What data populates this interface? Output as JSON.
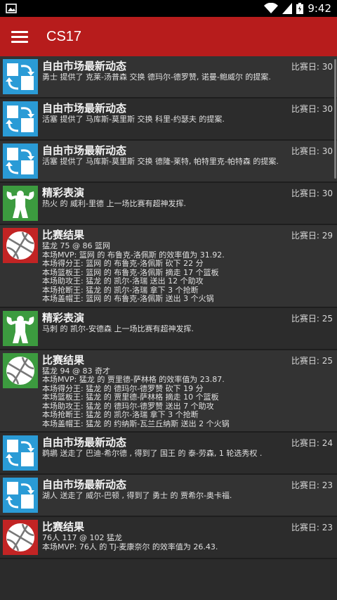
{
  "status": {
    "time": "9:42"
  },
  "toolbar": {
    "title": "CS17"
  },
  "colors": {
    "toolbar": "#b71c1c",
    "trade": "#2a9bd6",
    "star": "#3c9b3f",
    "result": "#c22424"
  },
  "items": [
    {
      "type": "trade",
      "title": "自由市场最新动态",
      "day": "比赛日: 30",
      "lines": [
        "勇士 提供了 克莱-汤普森 交换 德玛尔-德罗赞, 诺曼-鲍威尔 的提案."
      ]
    },
    {
      "type": "trade",
      "title": "自由市场最新动态",
      "day": "比赛日: 30",
      "lines": [
        "活塞 提供了 马库斯-莫里斯 交换 科里-约瑟夫 的提案."
      ]
    },
    {
      "type": "trade",
      "title": "自由市场最新动态",
      "day": "比赛日: 30",
      "lines": [
        "活塞 提供了 马库斯-莫里斯 交换 德隆-莱特, 帕特里克-帕特森 的提案."
      ]
    },
    {
      "type": "star",
      "title": "精彩表演",
      "day": "比赛日: 30",
      "lines": [
        "热火 的 威利-里德 上一场比赛有超神发挥."
      ]
    },
    {
      "type": "result",
      "title": "比赛结果",
      "day": "比赛日: 29",
      "lines": [
        "猛龙 75 @ 86 篮网",
        "本场MVP: 篮网 的 布鲁克-洛佩斯 的效率值为 31.92.",
        "本场得分王: 篮网 的 布鲁克-洛佩斯 砍下 22 分",
        "本场篮板王: 篮网 的 布鲁克-洛佩斯 摘走 17 个篮板",
        "本场助攻王: 猛龙 的 凯尔-洛瑞 送出 12 个助攻",
        "本场抢断王: 猛龙 的 凯尔-洛瑞 拿下 3 个抢断",
        "本场盖帽王: 篮网 的 布鲁克-洛佩斯 送出 3 个火锅"
      ]
    },
    {
      "type": "star",
      "title": "精彩表演",
      "day": "比赛日: 25",
      "lines": [
        "马刺 的 凯尔-安德森 上一场比赛有超神发挥."
      ]
    },
    {
      "type": "result-green",
      "title": "比赛结果",
      "day": "比赛日: 25",
      "lines": [
        "猛龙 94 @ 83 奇才",
        "本场MVP: 猛龙 的 贾里德-萨林格 的效率值为 23.87.",
        "本场得分王: 猛龙 的 德玛尔-德罗赞 砍下 19 分",
        "本场篮板王: 猛龙 的 贾里德-萨林格 摘走 10 个篮板",
        "本场助攻王: 猛龙 的 德玛尔-德罗赞 送出 7 个助攻",
        "本场抢断王: 猛龙 的 凯尔-洛瑞 拿下 3 个抢断",
        "本场盖帽王: 猛龙 的 约纳斯-瓦兰丘纳斯 送出 2 个火锅"
      ]
    },
    {
      "type": "trade",
      "title": "自由市场最新动态",
      "day": "比赛日: 24",
      "lines": [
        "鹈鹕 送走了 巴迪-希尔德 , 得到了 国王 的 泰-劳森, 1 轮选秀权 ."
      ]
    },
    {
      "type": "trade",
      "title": "自由市场最新动态",
      "day": "比赛日: 23",
      "lines": [
        "湖人 送走了 威尔-巴顿 , 得到了 勇士 的 贾希尔-奥卡福."
      ]
    },
    {
      "type": "result",
      "title": "比赛结果",
      "day": "比赛日: 23",
      "lines": [
        "76人 117 @ 102 猛龙",
        "本场MVP: 76人 的 TJ-麦康奈尔 的效率值为 26.43."
      ]
    }
  ]
}
